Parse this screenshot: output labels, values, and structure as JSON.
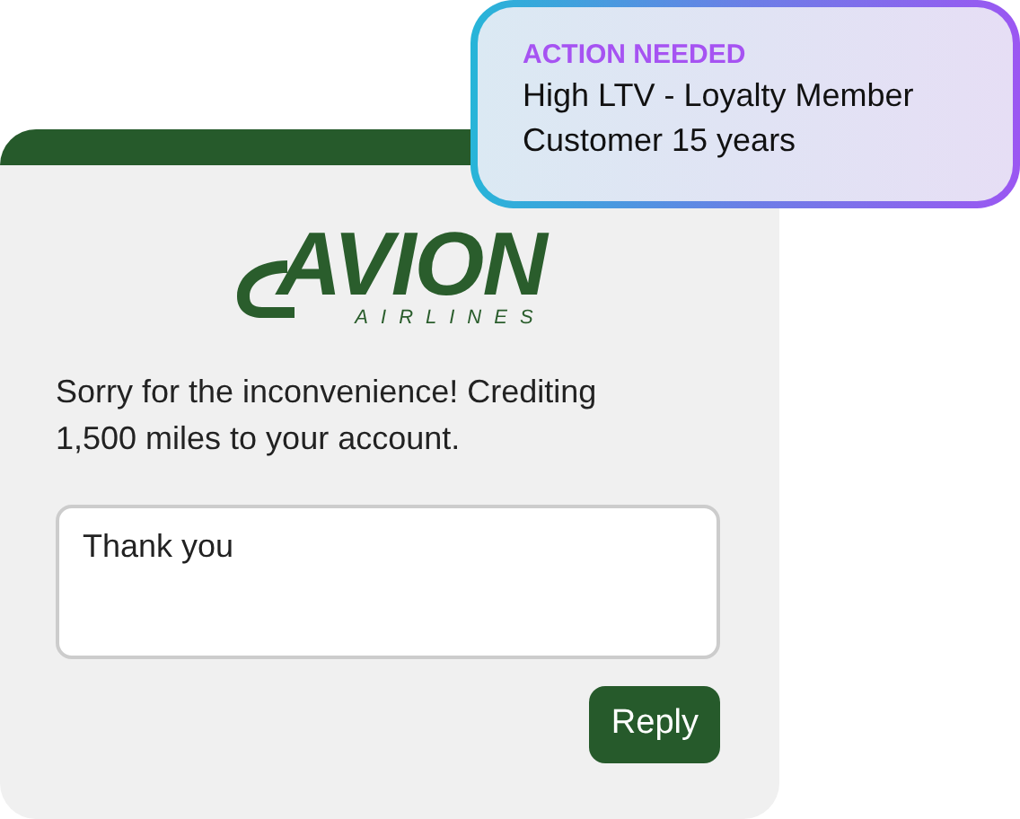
{
  "alert": {
    "label": "ACTION NEEDED",
    "lines": [
      "High LTV - Loyalty Member",
      "Customer 15 years"
    ]
  },
  "chat_card": {
    "logo": {
      "name": "AVION",
      "tagline": "AIRLINES"
    },
    "message": "Sorry for the inconvenience! Crediting 1,500 miles to your account.",
    "reply_field": {
      "value": "Thank you"
    },
    "button": "Reply"
  }
}
